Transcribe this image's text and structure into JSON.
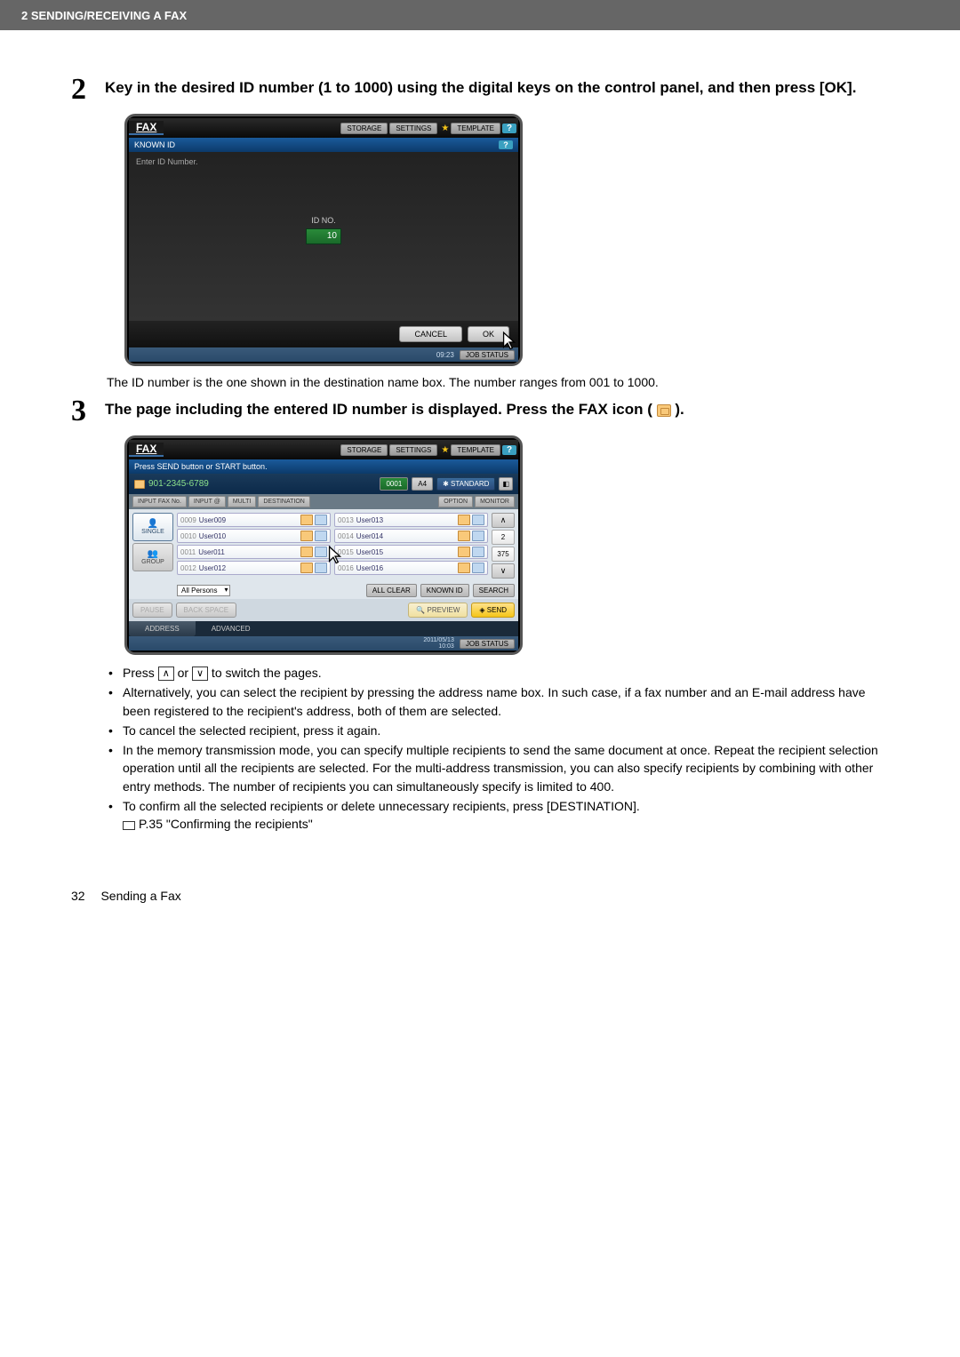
{
  "header": {
    "chapter": "2 SENDING/RECEIVING A FAX"
  },
  "step2": {
    "title": "Key in the desired ID number (1 to 1000) using the digital keys on the control panel, and then press [OK].",
    "caption": "The ID number is the one shown in the destination name box. The number ranges from 001 to 1000.",
    "screenshot": {
      "title": "FAX",
      "toolbar": {
        "storage": "STORAGE",
        "settings": "SETTINGS",
        "template": "TEMPLATE"
      },
      "sub_title": "KNOWN ID",
      "hint": "Enter ID Number.",
      "id_label": "ID NO.",
      "id_value": "10",
      "cancel": "CANCEL",
      "ok": "OK",
      "time": "09:23",
      "jobstatus": "JOB STATUS"
    }
  },
  "step3": {
    "title_prefix": "The page including the entered ID number is displayed. Press the FAX icon (",
    "title_suffix": ").",
    "screenshot": {
      "title": "FAX",
      "toolbar": {
        "storage": "STORAGE",
        "settings": "SETTINGS",
        "template": "TEMPLATE"
      },
      "sub_msg": "Press SEND button or START button.",
      "recipient": "901-2345-6789",
      "rec_id": "0001",
      "paper": "A4",
      "quality": "STANDARD",
      "input_tabs": {
        "faxno": "INPUT FAX No.",
        "at": "INPUT @",
        "multi": "MULTI",
        "dest": "DESTINATION",
        "option": "OPTION",
        "monitor": "MONITOR"
      },
      "side": {
        "single": "SINGLE",
        "group": "GROUP"
      },
      "entries_left": [
        {
          "num": "0009",
          "name": "User009"
        },
        {
          "num": "0010",
          "name": "User010"
        },
        {
          "num": "0011",
          "name": "User011"
        },
        {
          "num": "0012",
          "name": "User012"
        }
      ],
      "entries_right": [
        {
          "num": "0013",
          "name": "User013"
        },
        {
          "num": "0014",
          "name": "User014"
        },
        {
          "num": "0015",
          "name": "User015"
        },
        {
          "num": "0016",
          "name": "User016"
        }
      ],
      "scroll": {
        "page": "2",
        "total": "375"
      },
      "dropdown": "All Persons",
      "allclear": "ALL CLEAR",
      "knownid": "KNOWN ID",
      "search": "SEARCH",
      "pause": "PAUSE",
      "backspace": "BACK SPACE",
      "preview": "PREVIEW",
      "send": "SEND",
      "bottom_tabs": {
        "address": "ADDRESS",
        "advanced": "ADVANCED"
      },
      "timestamp_line1": "2011/05/13",
      "timestamp_line2": "10:03",
      "jobstatus": "JOB STATUS"
    },
    "notes": {
      "n1_a": "Press ",
      "n1_b": " or ",
      "n1_c": " to switch the pages.",
      "n2": "Alternatively, you can select the recipient by pressing the address name box. In such case, if a fax number and an E-mail address have been registered to the recipient's address, both of them are selected.",
      "n3": "To cancel the selected recipient, press it again.",
      "n4": "In the memory transmission mode, you can specify multiple recipients to send the same document at once. Repeat the recipient selection operation until all the recipients are selected. For the multi-address transmission, you can also specify recipients by combining with other entry methods. The number of recipients you can simultaneously specify is limited to 400.",
      "n5": "To confirm all the selected recipients or delete unnecessary recipients, press [DESTINATION].",
      "n5_ref": "P.35 \"Confirming the recipients\""
    }
  },
  "footer": {
    "page": "32",
    "section": "Sending a Fax"
  }
}
